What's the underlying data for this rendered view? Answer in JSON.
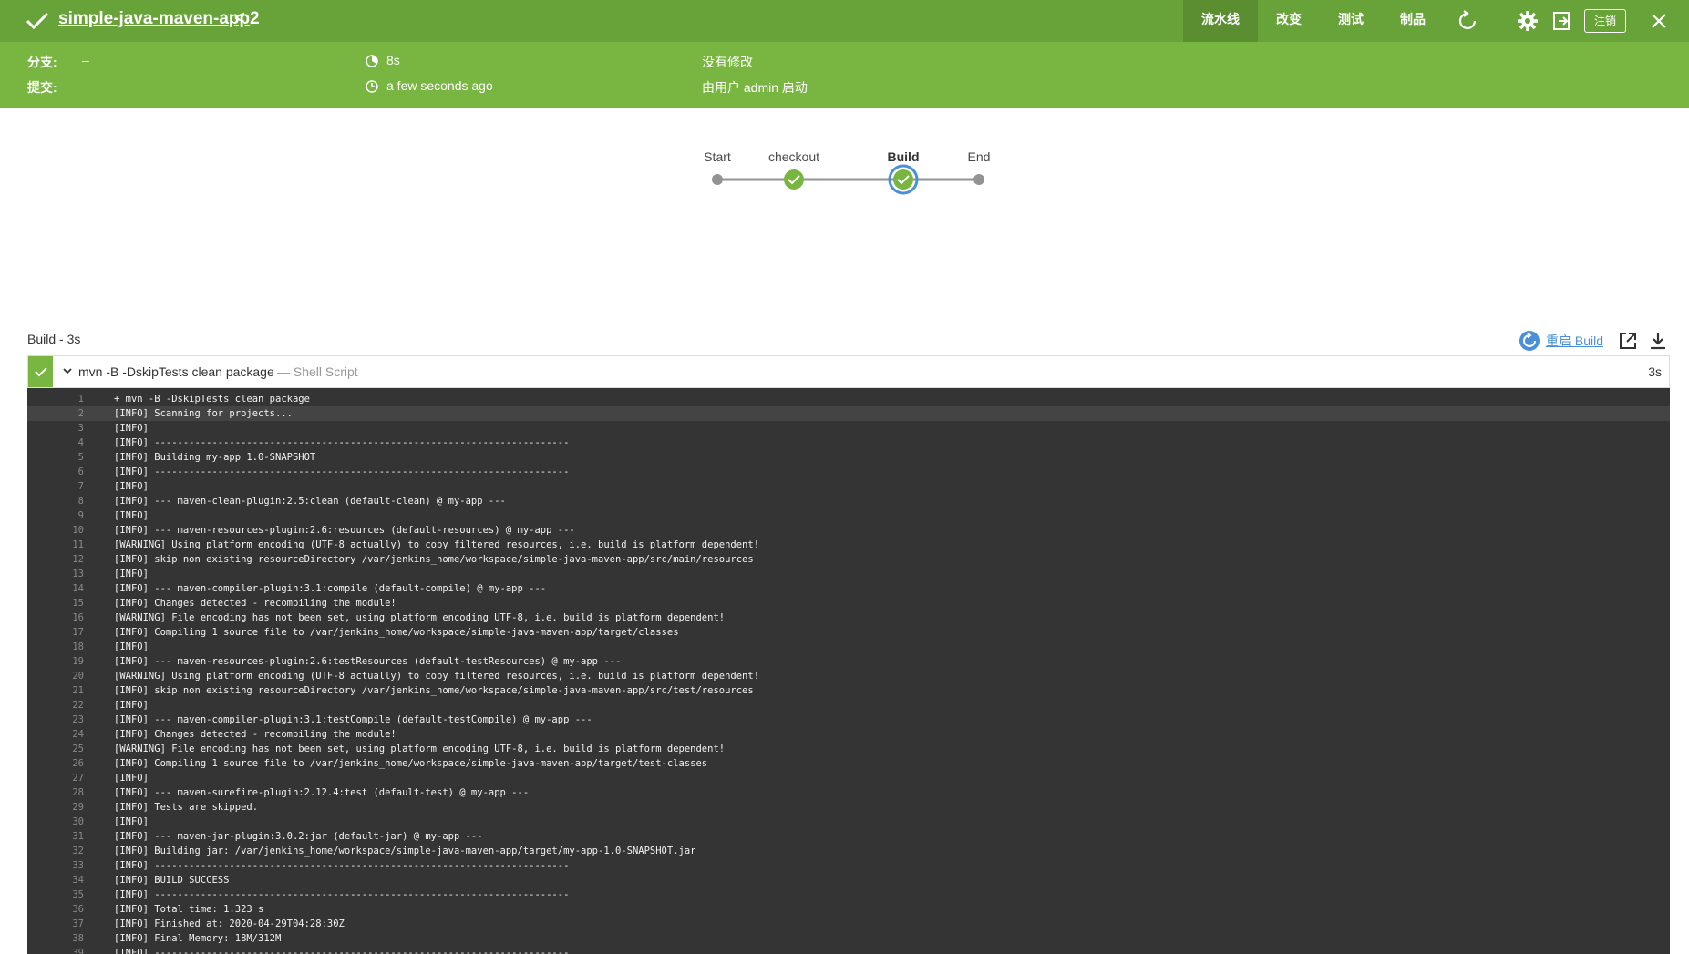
{
  "header": {
    "pipeline_name": "simple-java-maven-app",
    "chevron": "<",
    "run_number": "2",
    "tabs": [
      "流水线",
      "改变",
      "测试",
      "制品"
    ],
    "active_tab": "流水线",
    "logout_label": "注销",
    "icons": [
      "check-icon",
      "replay-icon",
      "settings-icon",
      "exit-icon",
      "close-icon"
    ]
  },
  "summary": {
    "branch_label": "分支:",
    "branch_value": "–",
    "commit_label": "提交:",
    "commit_value": "–",
    "duration": "8s",
    "time_ago": "a few seconds ago",
    "changes": "没有修改",
    "started_by": "由用户 admin 启动"
  },
  "stages": [
    "Start",
    "checkout",
    "Build",
    "End"
  ],
  "selected_stage": "Build",
  "step": {
    "title": "Build - 3s",
    "restart_label": "重启 Build",
    "command": "mvn -B -DskipTests clean package",
    "type": "— Shell Script",
    "duration": "3s"
  },
  "console": {
    "highlight_line": 2,
    "lines": [
      "+ mvn -B -DskipTests clean package",
      "[INFO] Scanning for projects...",
      "[INFO]",
      "[INFO] ------------------------------------------------------------------------",
      "[INFO] Building my-app 1.0-SNAPSHOT",
      "[INFO] ------------------------------------------------------------------------",
      "[INFO]",
      "[INFO] --- maven-clean-plugin:2.5:clean (default-clean) @ my-app ---",
      "[INFO]",
      "[INFO] --- maven-resources-plugin:2.6:resources (default-resources) @ my-app ---",
      "[WARNING] Using platform encoding (UTF-8 actually) to copy filtered resources, i.e. build is platform dependent!",
      "[INFO] skip non existing resourceDirectory /var/jenkins_home/workspace/simple-java-maven-app/src/main/resources",
      "[INFO]",
      "[INFO] --- maven-compiler-plugin:3.1:compile (default-compile) @ my-app ---",
      "[INFO] Changes detected - recompiling the module!",
      "[WARNING] File encoding has not been set, using platform encoding UTF-8, i.e. build is platform dependent!",
      "[INFO] Compiling 1 source file to /var/jenkins_home/workspace/simple-java-maven-app/target/classes",
      "[INFO]",
      "[INFO] --- maven-resources-plugin:2.6:testResources (default-testResources) @ my-app ---",
      "[WARNING] Using platform encoding (UTF-8 actually) to copy filtered resources, i.e. build is platform dependent!",
      "[INFO] skip non existing resourceDirectory /var/jenkins_home/workspace/simple-java-maven-app/src/test/resources",
      "[INFO]",
      "[INFO] --- maven-compiler-plugin:3.1:testCompile (default-testCompile) @ my-app ---",
      "[INFO] Changes detected - recompiling the module!",
      "[WARNING] File encoding has not been set, using platform encoding UTF-8, i.e. build is platform dependent!",
      "[INFO] Compiling 1 source file to /var/jenkins_home/workspace/simple-java-maven-app/target/test-classes",
      "[INFO]",
      "[INFO] --- maven-surefire-plugin:2.12.4:test (default-test) @ my-app ---",
      "[INFO] Tests are skipped.",
      "[INFO]",
      "[INFO] --- maven-jar-plugin:3.0.2:jar (default-jar) @ my-app ---",
      "[INFO] Building jar: /var/jenkins_home/workspace/simple-java-maven-app/target/my-app-1.0-SNAPSHOT.jar",
      "[INFO] ------------------------------------------------------------------------",
      "[INFO] BUILD SUCCESS",
      "[INFO] ------------------------------------------------------------------------",
      "[INFO] Total time: 1.323 s",
      "[INFO] Finished at: 2020-04-29T04:28:30Z",
      "[INFO] Final Memory: 18M/312M",
      "[INFO] ------------------------------------------------------------------------"
    ]
  },
  "colors": {
    "topbar": "#68a33a",
    "summary": "#78b541",
    "success": "#78b541",
    "selected_ring": "#4a90d9",
    "console_bg": "#343434",
    "link": "#4a90d9"
  }
}
